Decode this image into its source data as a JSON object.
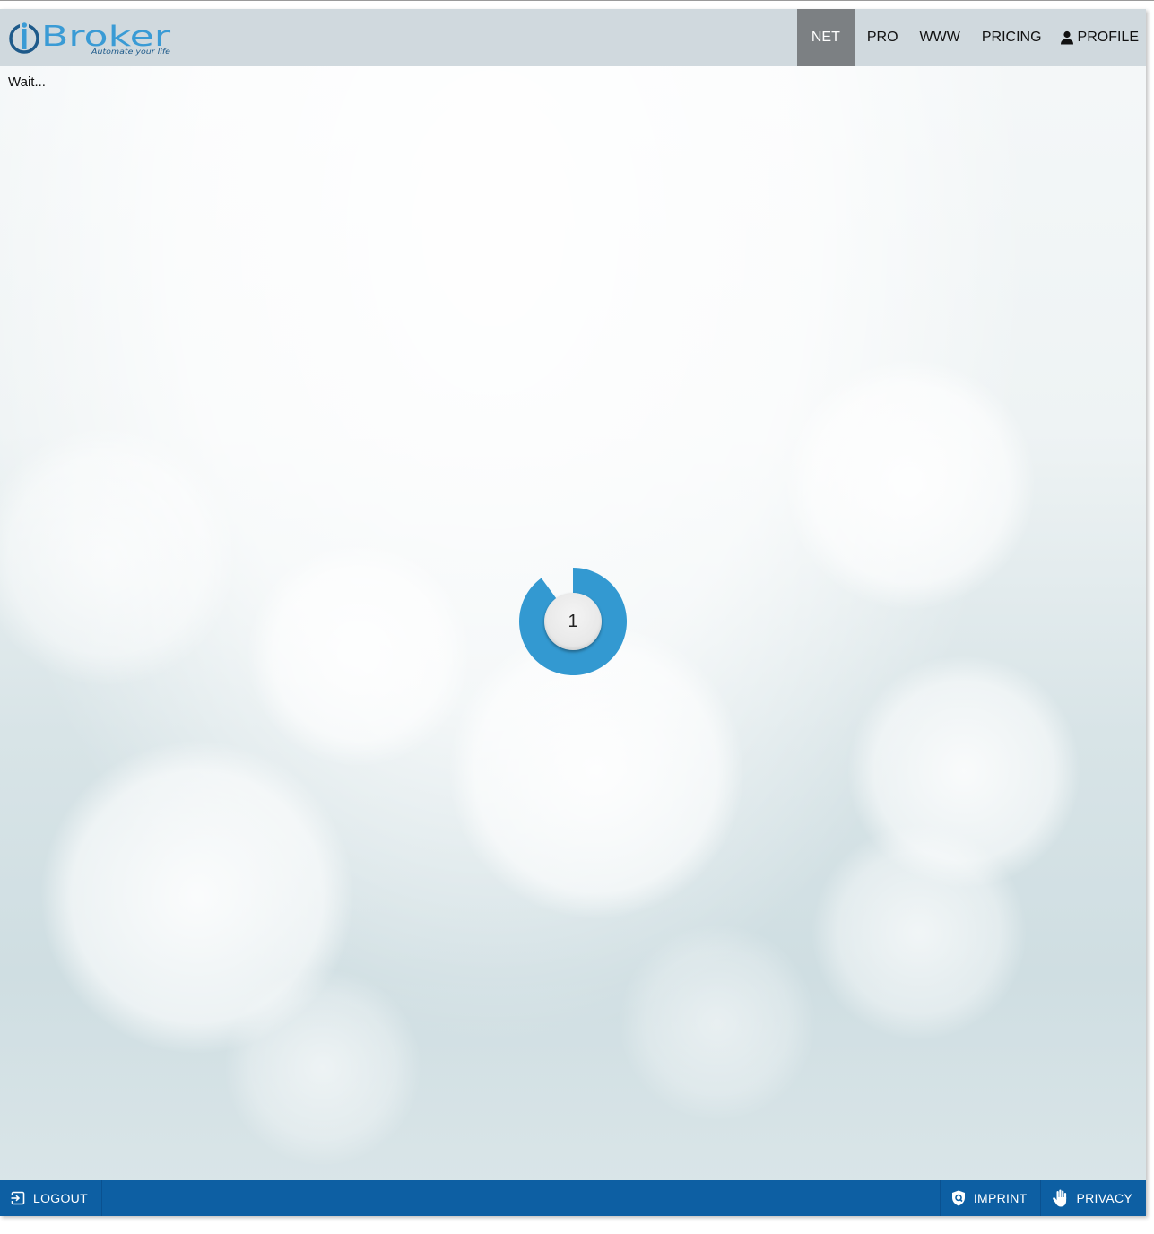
{
  "logo": {
    "wordmark": "Broker",
    "tagline": "Automate your life",
    "brand_color": "#3a9bd5",
    "dark_color": "#1e5a8a"
  },
  "navbar": {
    "items": [
      {
        "label": "NET",
        "active": true
      },
      {
        "label": "PRO",
        "active": false
      },
      {
        "label": "WWW",
        "active": false
      },
      {
        "label": "PRICING",
        "active": false
      },
      {
        "label": "PROFILE",
        "active": false,
        "icon": "person-icon"
      }
    ],
    "background": "#d0d9de",
    "active_background": "#7c8083"
  },
  "main": {
    "status_text": "Wait...",
    "spinner": {
      "value": "1",
      "progress_fraction": 0.9,
      "color": "#3399d1"
    }
  },
  "footer": {
    "background": "#0d5fa3",
    "left": [
      {
        "label": "LOGOUT",
        "icon": "logout-icon"
      }
    ],
    "right": [
      {
        "label": "IMPRINT",
        "icon": "shield-icon"
      },
      {
        "label": "PRIVACY",
        "icon": "hand-icon"
      }
    ]
  }
}
